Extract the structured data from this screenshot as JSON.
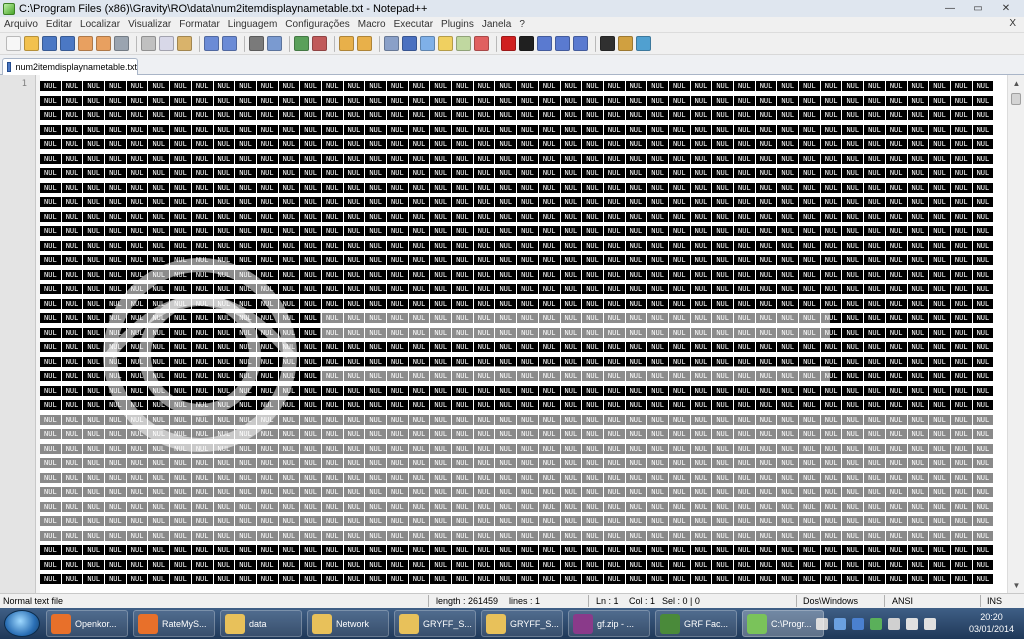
{
  "window": {
    "title": "C:\\Program Files (x86)\\Gravity\\RO\\data\\num2itemdisplaynametable.txt - Notepad++",
    "controls": {
      "minimize": "—",
      "maximize": "▭",
      "close": "✕"
    }
  },
  "menu": {
    "items": [
      "Arquivo",
      "Editar",
      "Localizar",
      "Visualizar",
      "Formatar",
      "Linguagem",
      "Configurações",
      "Macro",
      "Executar",
      "Plugins",
      "Janela",
      "?"
    ],
    "close_doc": "X"
  },
  "toolbar": {
    "icons": [
      {
        "name": "new-file-icon",
        "color": "#f7f7f7"
      },
      {
        "name": "open-file-icon",
        "color": "#f2c14e"
      },
      {
        "name": "save-icon",
        "color": "#4b78c4"
      },
      {
        "name": "save-all-icon",
        "color": "#4b78c4"
      },
      {
        "name": "close-icon",
        "color": "#e8a060"
      },
      {
        "name": "close-all-icon",
        "color": "#e8a060"
      },
      {
        "name": "print-icon",
        "color": "#9aa4b0"
      },
      {
        "name": "sep"
      },
      {
        "name": "cut-icon",
        "color": "#c0c0c0"
      },
      {
        "name": "copy-icon",
        "color": "#d8d8e8"
      },
      {
        "name": "paste-icon",
        "color": "#d9b36b"
      },
      {
        "name": "sep"
      },
      {
        "name": "undo-icon",
        "color": "#6b8bd6"
      },
      {
        "name": "redo-icon",
        "color": "#6b8bd6"
      },
      {
        "name": "sep"
      },
      {
        "name": "find-icon",
        "color": "#7a7a7a"
      },
      {
        "name": "replace-icon",
        "color": "#7a9ad0"
      },
      {
        "name": "sep"
      },
      {
        "name": "zoom-in-icon",
        "color": "#5aa05a"
      },
      {
        "name": "zoom-out-icon",
        "color": "#c05a5a"
      },
      {
        "name": "sep"
      },
      {
        "name": "sync-vertical-icon",
        "color": "#e8b04a"
      },
      {
        "name": "sync-horizontal-icon",
        "color": "#e8b04a"
      },
      {
        "name": "sep"
      },
      {
        "name": "word-wrap-icon",
        "color": "#8aa0c8"
      },
      {
        "name": "show-all-chars-icon",
        "color": "#4a70c0"
      },
      {
        "name": "indent-guide-icon",
        "color": "#7fb0e8"
      },
      {
        "name": "user-lang-icon",
        "color": "#f0d060"
      },
      {
        "name": "doc-map-icon",
        "color": "#c0d8a0"
      },
      {
        "name": "function-list-icon",
        "color": "#e06060"
      },
      {
        "name": "sep"
      },
      {
        "name": "record-macro-icon",
        "color": "#d02020"
      },
      {
        "name": "stop-macro-icon",
        "color": "#202020"
      },
      {
        "name": "play-macro-icon",
        "color": "#5a7ad0"
      },
      {
        "name": "play-multiple-icon",
        "color": "#5a7ad0"
      },
      {
        "name": "save-macro-icon",
        "color": "#5a7ad0"
      },
      {
        "name": "sep"
      },
      {
        "name": "ds-icon",
        "color": "#303030"
      },
      {
        "name": "plugin-icon",
        "color": "#d0a040"
      },
      {
        "name": "spellcheck-icon",
        "color": "#50a0d0"
      }
    ]
  },
  "tab": {
    "label": "num2itemdisplaynametable.txt"
  },
  "editor": {
    "line_number": "1",
    "token": "NUL"
  },
  "status": {
    "file_type": "Normal text file",
    "length": "length : 261459",
    "lines": "lines : 1",
    "ln": "Ln : 1",
    "col": "Col : 1",
    "sel": "Sel : 0 | 0",
    "eol": "Dos\\Windows",
    "encoding": "ANSI",
    "mode": "INS"
  },
  "taskbar": {
    "items": [
      {
        "label": "Openkor...",
        "icon": "firefox-icon",
        "color": "#e8702a"
      },
      {
        "label": "RateMyS...",
        "icon": "firefox-icon",
        "color": "#e8702a"
      },
      {
        "label": "data",
        "icon": "folder-icon",
        "color": "#e8c15a"
      },
      {
        "label": "Network",
        "icon": "folder-icon",
        "color": "#e8c15a"
      },
      {
        "label": "GRYFF_S...",
        "icon": "folder-icon",
        "color": "#e8c15a"
      },
      {
        "label": "GRYFF_S...",
        "icon": "folder-icon",
        "color": "#e8c15a"
      },
      {
        "label": "gf.zip - ...",
        "icon": "winrar-icon",
        "color": "#8a3a8a"
      },
      {
        "label": "GRF Fac...",
        "icon": "grf-icon",
        "color": "#4a8a3a"
      },
      {
        "label": "C:\\Progr...",
        "icon": "notepadpp-icon",
        "color": "#7ac35a"
      }
    ],
    "clock_time": "20:20",
    "clock_date": "03/01/2014"
  }
}
